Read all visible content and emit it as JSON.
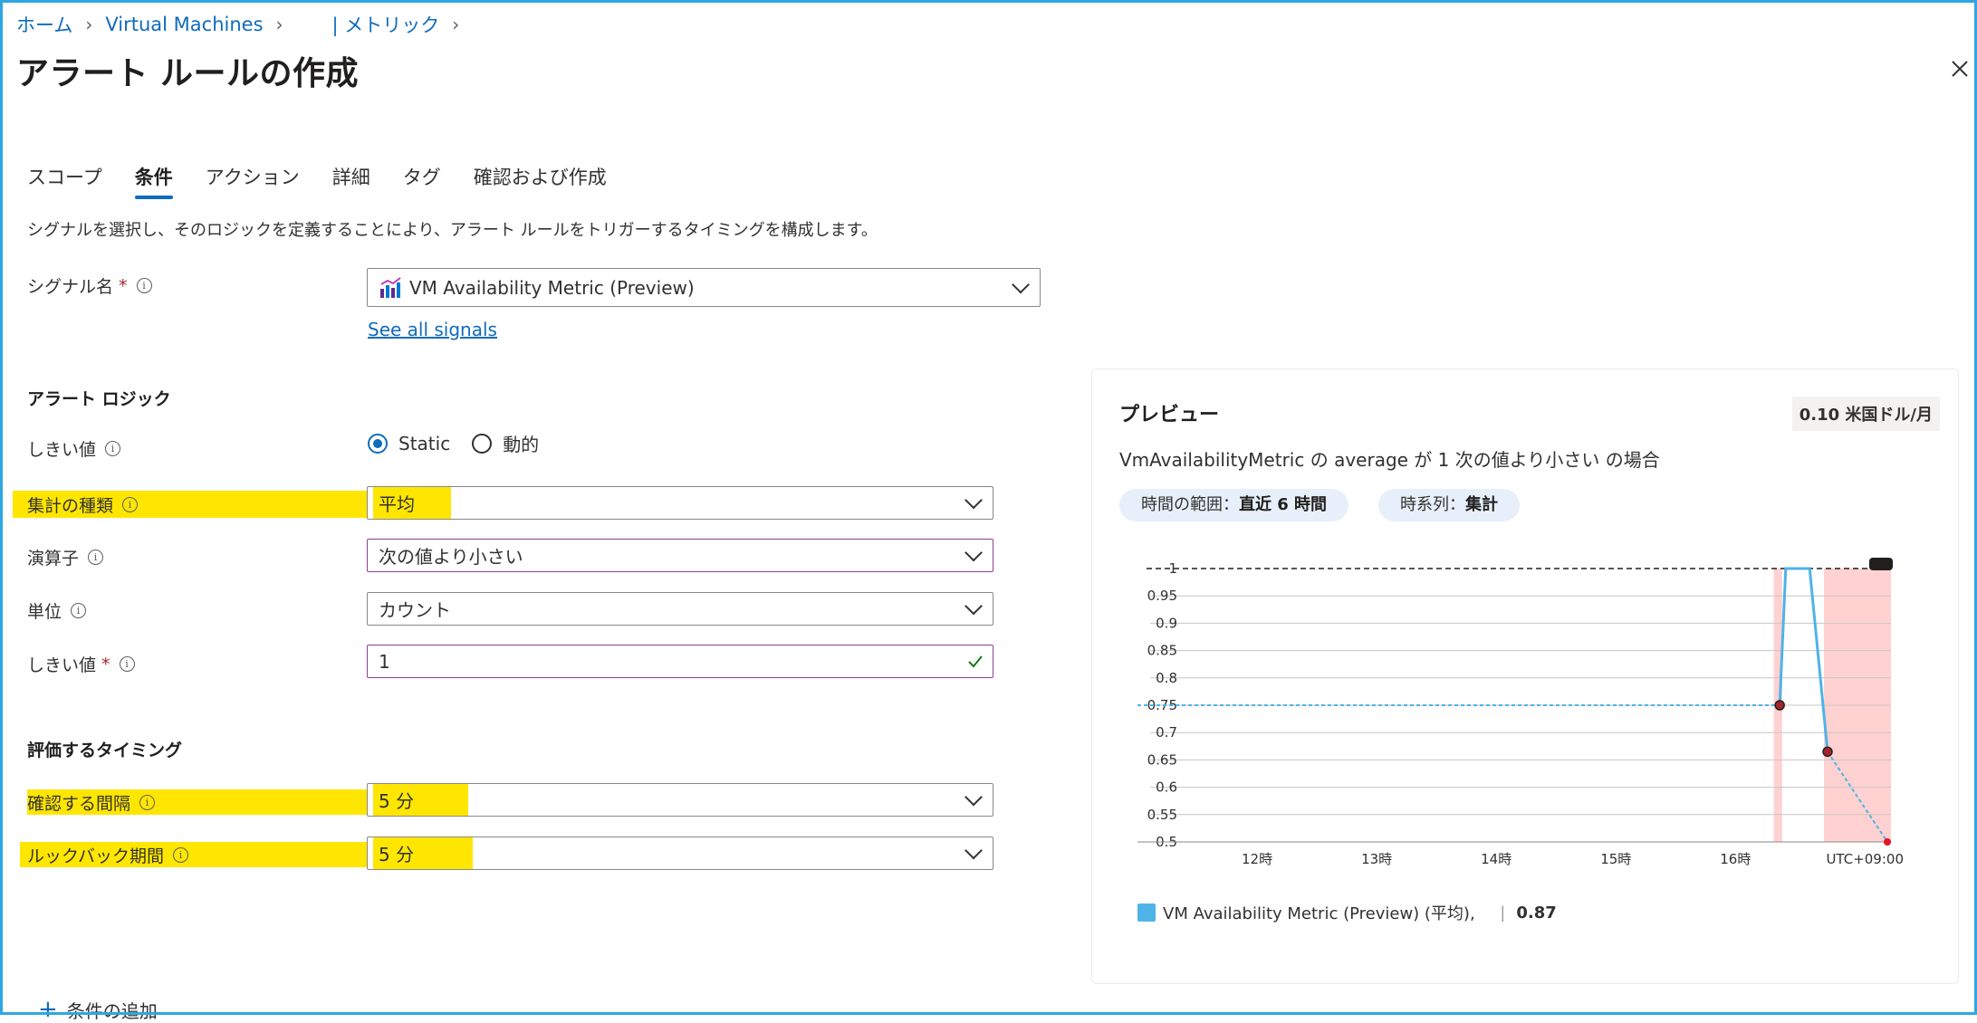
{
  "breadcrumb": {
    "items": [
      "ホーム",
      "Virtual Machines",
      "| メトリック"
    ]
  },
  "page": {
    "title": "アラート ルールの作成",
    "more": "···"
  },
  "tabs": [
    "スコープ",
    "条件",
    "アクション",
    "詳細",
    "タグ",
    "確認および作成"
  ],
  "active_tab": "条件",
  "description": "シグナルを選択し、そのロジックを定義することにより、アラート ルールをトリガーするタイミングを構成します。",
  "signal": {
    "label": "シグナル名",
    "required": "*",
    "value": "VM Availability Metric (Preview)",
    "see_all": "See all signals"
  },
  "alert_logic": {
    "section": "アラート ロジック",
    "threshold_type_label": "しきい値",
    "threshold_options": [
      "Static",
      "動的"
    ],
    "threshold_selected": "Static",
    "aggregation_label": "集計の種類",
    "aggregation_value": "平均",
    "operator_label": "演算子",
    "operator_value": "次の値より小さい",
    "unit_label": "単位",
    "unit_value": "カウント",
    "threshold_value_label": "しきい値",
    "threshold_value_required": "*",
    "threshold_value": "1"
  },
  "evaluation": {
    "section": "評価するタイミング",
    "check_every_label": "確認する間隔",
    "check_every_value": "5 分",
    "lookback_label": "ルックバック期間",
    "lookback_value": "5 分"
  },
  "add_condition": "条件の追加",
  "preview": {
    "title": "プレビュー",
    "cost": "0.10 米国ドル/月",
    "condition": "VmAvailabilityMetric の average が 1 次の値より小さい の場合",
    "time_range_label": "時間の範囲：",
    "time_range_value": "直近 6 時間",
    "series_label": "時系列：",
    "series_value": "集計",
    "legend_name": "VM Availability Metric (Preview) (平均),",
    "legend_value": "0.87"
  },
  "colors": {
    "accent": "#0f6cbd",
    "highlight": "#ffe600",
    "series": "#4fb3e8",
    "alert_band": "#ffc9c9",
    "border_frame": "#2ea7e0"
  },
  "chart_data": {
    "type": "line",
    "ylim": [
      0.5,
      1
    ],
    "y_ticks": [
      "1",
      "0.95",
      "0.9",
      "0.85",
      "0.8",
      "0.75",
      "0.7",
      "0.65",
      "0.6",
      "0.55",
      "0.5"
    ],
    "x_ticks": [
      "12時",
      "13時",
      "14時",
      "15時",
      "16時"
    ],
    "x_range_hours": [
      11.0,
      17.3
    ],
    "timezone_label": "UTC+09:00",
    "threshold": 1,
    "series": [
      {
        "name": "VM Availability Metric (Preview) (平均)",
        "solid": [
          [
            16.37,
            0.75
          ],
          [
            16.42,
            1.0
          ],
          [
            16.62,
            1.0
          ],
          [
            16.77,
            0.665
          ]
        ],
        "dashed_before": [
          [
            11.0,
            0.75
          ],
          [
            16.37,
            0.75
          ]
        ],
        "dashed_after": [
          [
            16.77,
            0.665
          ],
          [
            17.27,
            0.5
          ]
        ],
        "markers": [
          [
            16.37,
            0.75
          ],
          [
            16.77,
            0.665
          ]
        ],
        "end_marker": [
          17.27,
          0.5
        ]
      }
    ],
    "alert_bands_hours": [
      [
        16.32,
        16.39
      ],
      [
        16.74,
        17.3
      ]
    ]
  }
}
